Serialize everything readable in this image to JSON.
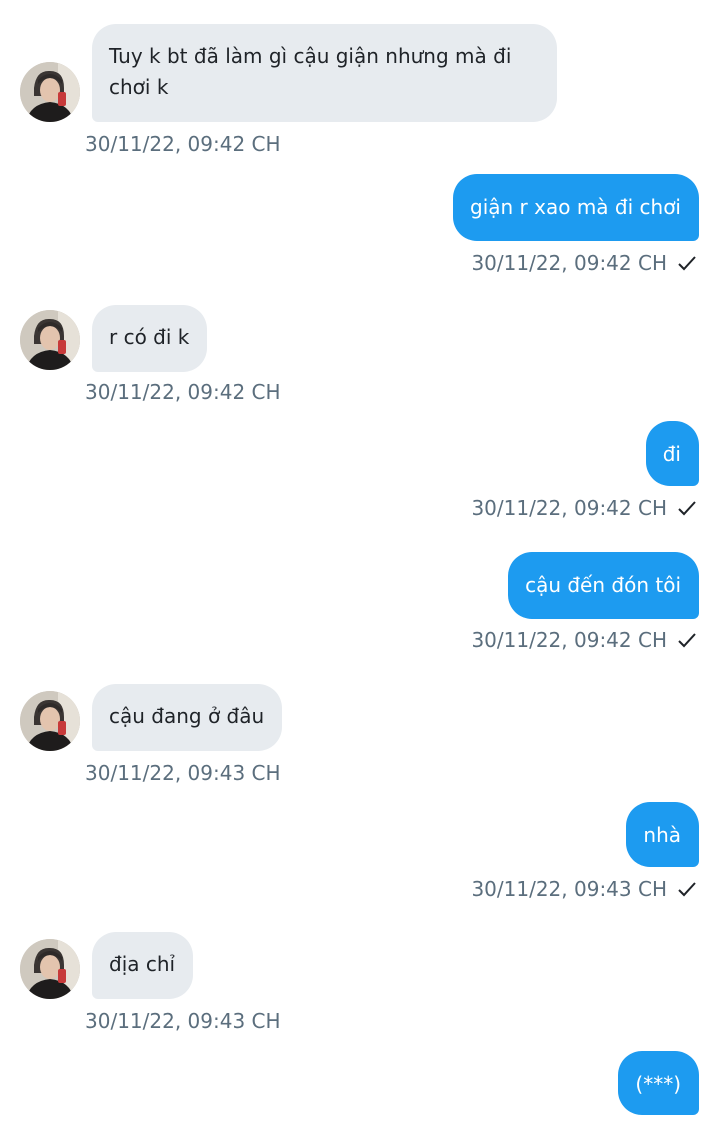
{
  "messages": [
    {
      "from": "them",
      "text": "Tuy k bt đã làm gì cậu giận nhưng mà đi chơi k",
      "time": "30/11/22,  09:42 CH"
    },
    {
      "from": "me",
      "text": "giận r xao mà đi chơi",
      "time": "30/11/22,  09:42 CH",
      "status": "check-icon"
    },
    {
      "from": "them",
      "text": "r có đi k",
      "time": "30/11/22,  09:42 CH"
    },
    {
      "from": "me",
      "text": "đi",
      "time": "30/11/22,  09:42 CH",
      "status": "check-icon"
    },
    {
      "from": "me",
      "text": "cậu đến đón tôi",
      "time": "30/11/22,  09:42 CH",
      "status": "check-icon"
    },
    {
      "from": "them",
      "text": "cậu đang ở đâu",
      "time": "30/11/22,  09:43 CH"
    },
    {
      "from": "me",
      "text": "nhà",
      "time": "30/11/22,  09:43 CH",
      "status": "check-icon"
    },
    {
      "from": "them",
      "text": "địa chỉ",
      "time": "30/11/22,  09:43 CH"
    },
    {
      "from": "me",
      "text": "(***)"
    }
  ],
  "colors": {
    "incoming_bubble": "#e7ebef",
    "outgoing_bubble": "#1d9bf0",
    "timestamp": "#5b6e7d"
  }
}
